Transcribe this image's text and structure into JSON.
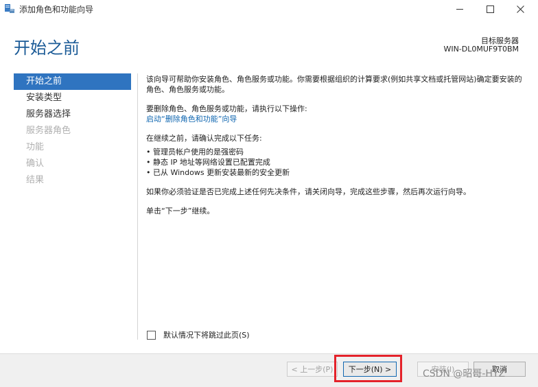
{
  "window": {
    "title": "添加角色和功能向导",
    "icon": "server-manager-icon"
  },
  "header": {
    "page_title": "开始之前",
    "server_label": "目标服务器",
    "server_name": "WIN-DL0MUF9T0BM"
  },
  "nav": {
    "items": [
      {
        "label": "开始之前",
        "state": "active"
      },
      {
        "label": "安装类型",
        "state": "enabled"
      },
      {
        "label": "服务器选择",
        "state": "enabled"
      },
      {
        "label": "服务器角色",
        "state": "disabled"
      },
      {
        "label": "功能",
        "state": "disabled"
      },
      {
        "label": "确认",
        "state": "disabled"
      },
      {
        "label": "结果",
        "state": "disabled"
      }
    ]
  },
  "content": {
    "intro": "该向导可帮助你安装角色、角色服务或功能。你需要根据组织的计算要求(例如共享文档或托管网站)确定要安装的角色、角色服务或功能。",
    "remove_heading": "要删除角色、角色服务或功能，请执行以下操作:",
    "remove_link": "启动“删除角色和功能”向导",
    "tasks_heading": "在继续之前，请确认完成以下任务:",
    "bullets": [
      "管理员帐户使用的是强密码",
      "静态 IP 地址等网络设置已配置完成",
      "已从 Windows 更新安装最新的安全更新"
    ],
    "verify_note": "如果你必须验证是否已完成上述任何先决条件，请关闭向导，完成这些步骤，然后再次运行向导。",
    "next_note": "单击“下一步”继续。",
    "skip_label": "默认情况下将跳过此页(S)",
    "skip_checked": false
  },
  "footer": {
    "prev_label": "< 上一步(P)",
    "next_label": "下一步(N) >",
    "install_label": "安装(I)",
    "cancel_label": "取消"
  },
  "watermark": "CSDN @昭哥-HYZ",
  "colors": {
    "accent": "#2f74c0",
    "title_blue": "#1a5a96",
    "link": "#0f66b0",
    "highlight_red": "#e4222a"
  }
}
